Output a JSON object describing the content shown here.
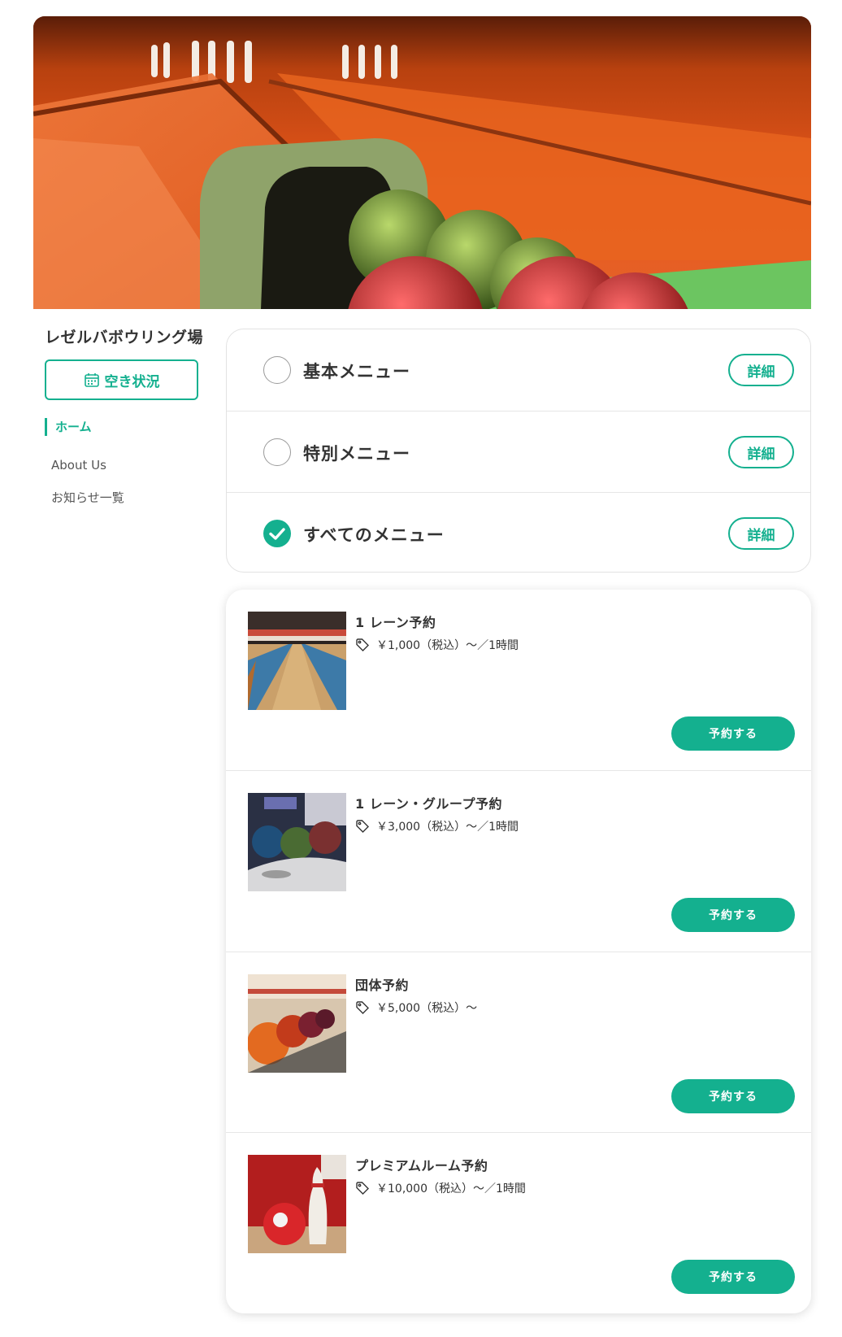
{
  "shop": {
    "name": "レゼルバボウリング場"
  },
  "sidebar": {
    "availability_label": "空き状況",
    "nav": [
      {
        "label": "ホーム",
        "active": true
      },
      {
        "label": "About Us",
        "active": false
      },
      {
        "label": "お知らせ一覧",
        "active": false
      }
    ]
  },
  "categories": [
    {
      "label": "基本メニュー",
      "selected": false,
      "detail_label": "詳細"
    },
    {
      "label": "特別メニュー",
      "selected": false,
      "detail_label": "詳細"
    },
    {
      "label": "すべてのメニュー",
      "selected": true,
      "detail_label": "詳細"
    }
  ],
  "plans": [
    {
      "title": "1 レーン予約",
      "price": "￥1,000（税込）〜／1時間",
      "button": "予約する",
      "image": "bowling-lanes-photo"
    },
    {
      "title": "1 レーン・グループ予約",
      "price": "￥3,000（税込）〜／1時間",
      "button": "予約する",
      "image": "bowling-balls-return-photo"
    },
    {
      "title": "団体予約",
      "price": "￥5,000（税込）〜",
      "button": "予約する",
      "image": "bowling-balls-rack-photo"
    },
    {
      "title": "プレミアムルーム予約",
      "price": "￥10,000（税込）〜／1時間",
      "button": "予約する",
      "image": "bowling-pin-ball-photo"
    }
  ],
  "colors": {
    "accent": "#14b08f",
    "text": "#333333",
    "border": "#e2e2e2"
  },
  "icons": {
    "calendar": "calendar-icon",
    "tag": "price-tag-icon",
    "check": "check-icon"
  }
}
